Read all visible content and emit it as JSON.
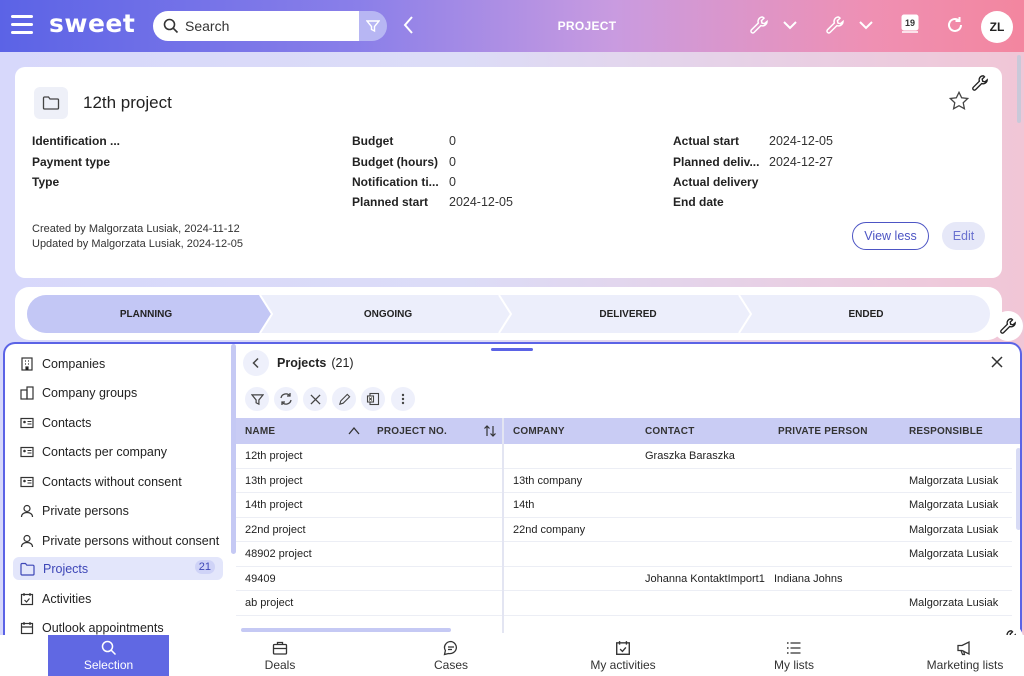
{
  "app": {
    "logo": "sweet",
    "page_title": "PROJECT",
    "avatar_initials": "ZL",
    "calendar_day": "19"
  },
  "search": {
    "placeholder": "Search"
  },
  "project": {
    "name": "12th project",
    "fields": [
      {
        "label": "Identification ...",
        "value": ""
      },
      {
        "label": "Payment type",
        "value": ""
      },
      {
        "label": "Type",
        "value": ""
      },
      {
        "label": "Budget",
        "value": "0"
      },
      {
        "label": "Budget (hours)",
        "value": "0"
      },
      {
        "label": "Notification ti...",
        "value": "0"
      },
      {
        "label": "Planned start",
        "value": "2024-12-05"
      },
      {
        "label": "Actual start",
        "value": "2024-12-05"
      },
      {
        "label": "Planned deliv...",
        "value": "2024-12-27"
      },
      {
        "label": "Actual delivery",
        "value": ""
      },
      {
        "label": "End date",
        "value": ""
      }
    ],
    "created": "Created by Malgorzata Lusiak, 2024-11-12",
    "updated": "Updated by Malgorzata Lusiak, 2024-12-05",
    "view_less_label": "View less",
    "edit_label": "Edit"
  },
  "stages": [
    "PLANNING",
    "ONGOING",
    "DELIVERED",
    "ENDED"
  ],
  "active_stage": "PLANNING",
  "sidebar": {
    "items": [
      {
        "label": "Companies",
        "icon": "building-icon"
      },
      {
        "label": "Company groups",
        "icon": "buildings-icon"
      },
      {
        "label": "Contacts",
        "icon": "contact-card-icon"
      },
      {
        "label": "Contacts per company",
        "icon": "contact-card-icon"
      },
      {
        "label": "Contacts without consent",
        "icon": "contact-card-icon"
      },
      {
        "label": "Private persons",
        "icon": "person-icon"
      },
      {
        "label": "Private persons without consent",
        "icon": "person-icon"
      },
      {
        "label": "Projects",
        "icon": "folder-icon",
        "badge": "21",
        "active": true
      },
      {
        "label": "Activities",
        "icon": "calendar-check-icon"
      },
      {
        "label": "Outlook appointments",
        "icon": "calendar-icon"
      }
    ]
  },
  "list": {
    "title": "Projects",
    "count": "(21)",
    "columns": [
      "NAME",
      "PROJECT NO.",
      "COMPANY",
      "CONTACT",
      "PRIVATE PERSON",
      "RESPONSIBLE"
    ],
    "rows": [
      {
        "name": "12th project",
        "project_no": "",
        "company": "",
        "contact": "Graszka Baraszka",
        "private_person": "",
        "responsible": ""
      },
      {
        "name": "13th project",
        "project_no": "",
        "company": "13th company",
        "contact": "",
        "private_person": "",
        "responsible": "Malgorzata Lusiak"
      },
      {
        "name": "14th project",
        "project_no": "",
        "company": "14th",
        "contact": "",
        "private_person": "",
        "responsible": "Malgorzata Lusiak"
      },
      {
        "name": "22nd project",
        "project_no": "",
        "company": "22nd company",
        "contact": "",
        "private_person": "",
        "responsible": "Malgorzata Lusiak"
      },
      {
        "name": "48902 project",
        "project_no": "",
        "company": "",
        "contact": "",
        "private_person": "",
        "responsible": "Malgorzata Lusiak"
      },
      {
        "name": "49409",
        "project_no": "",
        "company": "",
        "contact": "Johanna KontaktImport1",
        "private_person": "Indiana Johns",
        "responsible": ""
      },
      {
        "name": "ab project",
        "project_no": "",
        "company": "",
        "contact": "",
        "private_person": "",
        "responsible": "Malgorzata Lusiak"
      }
    ]
  },
  "bottom_nav": [
    {
      "label": "Selection",
      "icon": "search-icon",
      "active": true
    },
    {
      "label": "Deals",
      "icon": "briefcase-icon"
    },
    {
      "label": "Cases",
      "icon": "chat-icon"
    },
    {
      "label": "My activities",
      "icon": "calendar-check-icon"
    },
    {
      "label": "My lists",
      "icon": "list-icon"
    },
    {
      "label": "Marketing lists",
      "icon": "megaphone-icon"
    }
  ],
  "colors": {
    "accent": "#5b63e6",
    "header_gradient_start": "#5b63e6",
    "header_gradient_end": "#f3869f",
    "table_header": "#c9ccf4"
  }
}
